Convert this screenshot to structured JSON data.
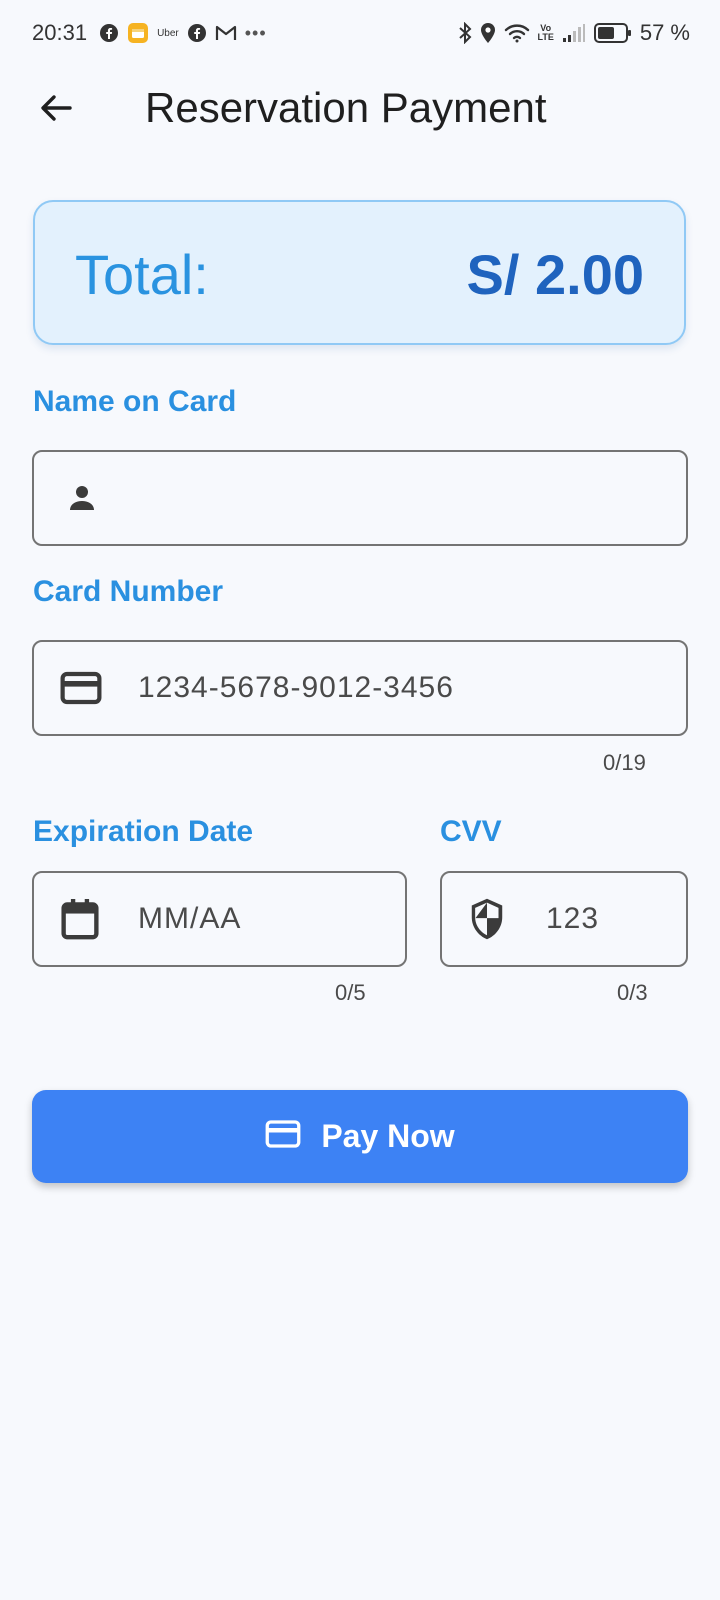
{
  "status_bar": {
    "time": "20:31",
    "uber_label": "Uber",
    "volte_top": "Vo",
    "volte_bottom": "LTE",
    "battery": "57 %"
  },
  "header": {
    "title": "Reservation Payment"
  },
  "total": {
    "label": "Total:",
    "amount": "S/ 2.00"
  },
  "form": {
    "name": {
      "label": "Name on Card",
      "value": ""
    },
    "card_number": {
      "label": "Card Number",
      "placeholder": "1234-5678-9012-3456",
      "counter": "0/19"
    },
    "expiration": {
      "label": "Expiration Date",
      "placeholder": "MM/AA",
      "counter": "0/5"
    },
    "cvv": {
      "label": "CVV",
      "placeholder": "123",
      "counter": "0/3"
    }
  },
  "pay_button": {
    "label": "Pay Now"
  },
  "colors": {
    "accent": "#2a90e0",
    "total_amount": "#1f63be",
    "pay_button": "#3d82f4",
    "total_card_bg": "#e3f1fd"
  },
  "icons": [
    "back-arrow-icon",
    "person-icon",
    "credit-card-icon",
    "calendar-icon",
    "shield-icon",
    "payment-card-icon"
  ]
}
